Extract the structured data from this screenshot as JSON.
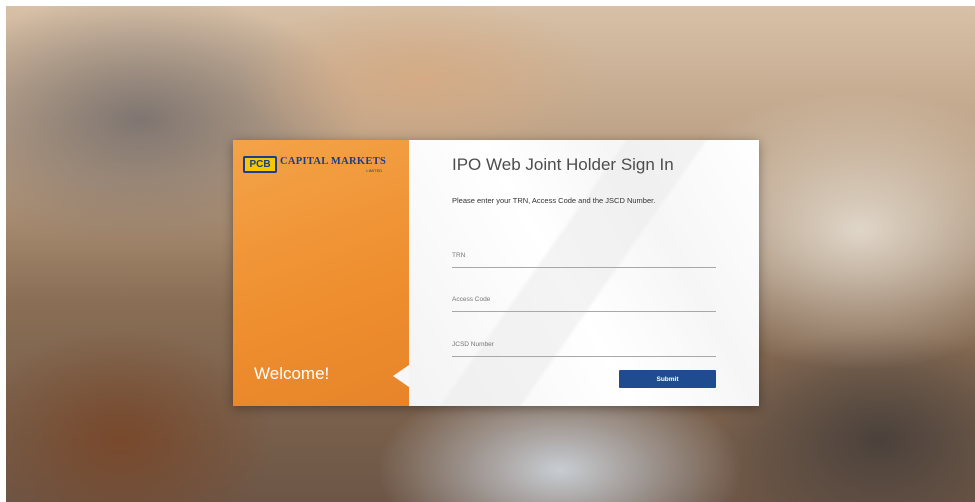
{
  "brand": {
    "badge": "PCB",
    "name": "CAPITAL MARKETS",
    "subtitle": "LIMITED"
  },
  "welcome_text": "Welcome!",
  "signin": {
    "title": "IPO Web Joint Holder Sign In",
    "instructions": "Please enter your TRN, Access Code and the JSCD Number.",
    "fields": [
      {
        "placeholder": "TRN",
        "value": ""
      },
      {
        "placeholder": "Access Code",
        "value": ""
      },
      {
        "placeholder": "JCSD Number",
        "value": ""
      }
    ],
    "submit_label": "Submit"
  },
  "colors": {
    "left_panel": "#ee8e2e",
    "submit_button": "#1f4c91",
    "logo_blue": "#1e3c8c",
    "logo_yellow": "#f6c800"
  }
}
